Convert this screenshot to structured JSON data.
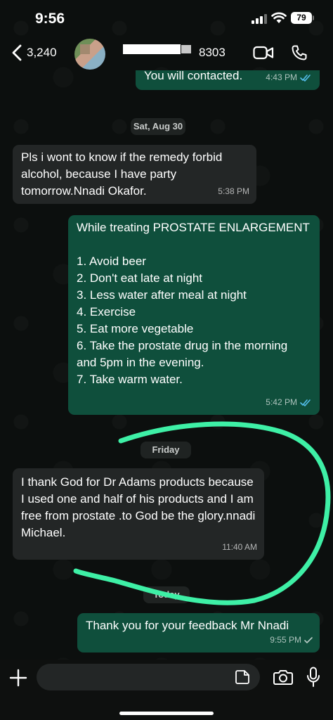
{
  "status_bar": {
    "time": "9:56",
    "battery": "79"
  },
  "header": {
    "back_count": "3,240",
    "contact_suffix": "8303"
  },
  "messages": [
    {
      "text": "You will contacted.",
      "time": "4:43 PM"
    },
    {
      "text": "Pls i wont to know if the remedy forbid alcohol, because I have party tomorrow.Nnadi Okafor.",
      "time": "5:38 PM"
    },
    {
      "text": "While treating PROSTATE ENLARGEMENT\n\n1. Avoid beer\n2. Don't eat late at night\n3. Less water after meal at night\n4. Exercise\n5. Eat more vegetable\n6. Take the prostate drug in the morning\n    and 5pm in the evening.\n7. Take warm water.",
      "time": "5:42 PM"
    },
    {
      "text": "I thank  God for Dr Adams products because I used one and half of his products and I am free from prostate .to God be the glory.nnadi Michael.",
      "time": "11:40 AM"
    },
    {
      "text": "Thank you for your feedback Mr Nnadi",
      "time": "9:55 PM"
    }
  ],
  "date_separators": [
    "Sat, Aug 30",
    "Friday",
    "Today"
  ],
  "input": {
    "placeholder": ""
  },
  "colors": {
    "outgoing_bubble": "#0f4f3c",
    "incoming_bubble": "#232626",
    "read_tick": "#53bdeb",
    "highlight_stroke": "#3ef0a6"
  }
}
